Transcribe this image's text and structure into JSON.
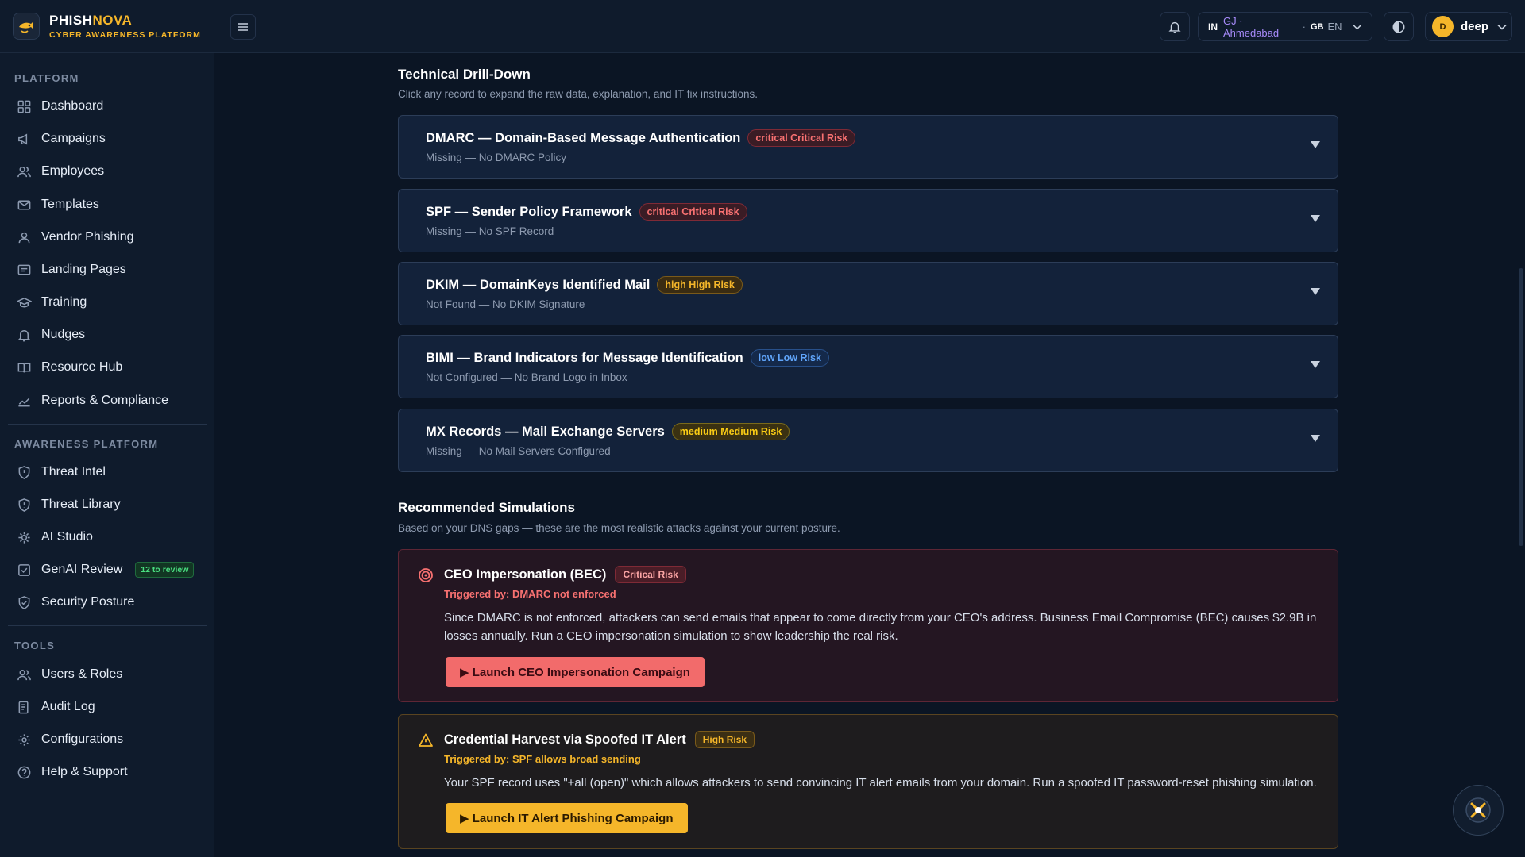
{
  "brand": {
    "name_a": "PHISH",
    "name_b": "NOVA",
    "subtitle": "CYBER AWARENESS PLATFORM"
  },
  "sidebar": {
    "sections": [
      {
        "label": "PLATFORM",
        "items": [
          {
            "label": "Dashboard",
            "icon": "grid-icon"
          },
          {
            "label": "Campaigns",
            "icon": "megaphone-icon"
          },
          {
            "label": "Employees",
            "icon": "users-icon"
          },
          {
            "label": "Templates",
            "icon": "mail-icon"
          },
          {
            "label": "Vendor Phishing",
            "icon": "user-icon"
          },
          {
            "label": "Landing Pages",
            "icon": "page-icon"
          },
          {
            "label": "Training",
            "icon": "graduation-cap-icon"
          },
          {
            "label": "Nudges",
            "icon": "bell-icon"
          },
          {
            "label": "Resource Hub",
            "icon": "book-icon"
          },
          {
            "label": "Reports & Compliance",
            "icon": "chart-icon"
          }
        ]
      },
      {
        "label": "AWARENESS PLATFORM",
        "items": [
          {
            "label": "Threat Intel",
            "icon": "shield-alert-icon"
          },
          {
            "label": "Threat Library",
            "icon": "shield-alert-icon"
          },
          {
            "label": "AI Studio",
            "icon": "ai-icon"
          },
          {
            "label": "GenAI Review",
            "icon": "check-square-icon",
            "badge": "12 to review"
          },
          {
            "label": "Security Posture",
            "icon": "shield-check-icon"
          }
        ]
      },
      {
        "label": "TOOLS",
        "items": [
          {
            "label": "Users & Roles",
            "icon": "users-icon"
          },
          {
            "label": "Audit Log",
            "icon": "log-icon"
          },
          {
            "label": "Configurations",
            "icon": "gear-icon"
          },
          {
            "label": "Help & Support",
            "icon": "help-icon"
          }
        ]
      }
    ]
  },
  "topbar": {
    "country_code": "IN",
    "location": "GJ · Ahmedabad",
    "separator": "·",
    "lang_flag": "GB",
    "lang": "EN",
    "user": "deep",
    "avatar_initial": "D"
  },
  "drilldown": {
    "title": "Technical Drill-Down",
    "subtitle": "Click any record to expand the raw data, explanation, and IT fix instructions.",
    "records": [
      {
        "title": "DMARC — Domain-Based Message Authentication",
        "risk": "critical Critical Risk",
        "level": "critical",
        "status": "Missing — No DMARC Policy"
      },
      {
        "title": "SPF — Sender Policy Framework",
        "risk": "critical Critical Risk",
        "level": "critical",
        "status": "Missing — No SPF Record"
      },
      {
        "title": "DKIM — DomainKeys Identified Mail",
        "risk": "high High Risk",
        "level": "high",
        "status": "Not Found — No DKIM Signature"
      },
      {
        "title": "BIMI — Brand Indicators for Message Identification",
        "risk": "low Low Risk",
        "level": "low",
        "status": "Not Configured — No Brand Logo in Inbox"
      },
      {
        "title": "MX Records — Mail Exchange Servers",
        "risk": "medium Medium Risk",
        "level": "medium",
        "status": "Missing — No Mail Servers Configured"
      }
    ]
  },
  "simulations": {
    "title": "Recommended Simulations",
    "subtitle": "Based on your DNS gaps — these are the most realistic attacks against your current posture.",
    "items": [
      {
        "title": "CEO Impersonation (BEC)",
        "tag": "Critical Risk",
        "trigger": "Triggered by: DMARC not enforced",
        "description": "Since DMARC is not enforced, attackers can send emails that appear to come directly from your CEO's address. Business Email Compromise (BEC) causes $2.9B in losses annually. Run a CEO impersonation simulation to show leadership the real risk.",
        "button": "▶ Launch CEO Impersonation Campaign",
        "accent": "#f87171"
      },
      {
        "title": "Credential Harvest via Spoofed IT Alert",
        "tag": "High Risk",
        "trigger": "Triggered by: SPF allows broad sending",
        "description": "Your SPF record uses \"+all (open)\" which allows attackers to send convincing IT alert emails from your domain. Run a spoofed IT password-reset phishing simulation.",
        "button": "▶ Launch IT Alert Phishing Campaign",
        "accent": "#f5b62a"
      }
    ]
  }
}
